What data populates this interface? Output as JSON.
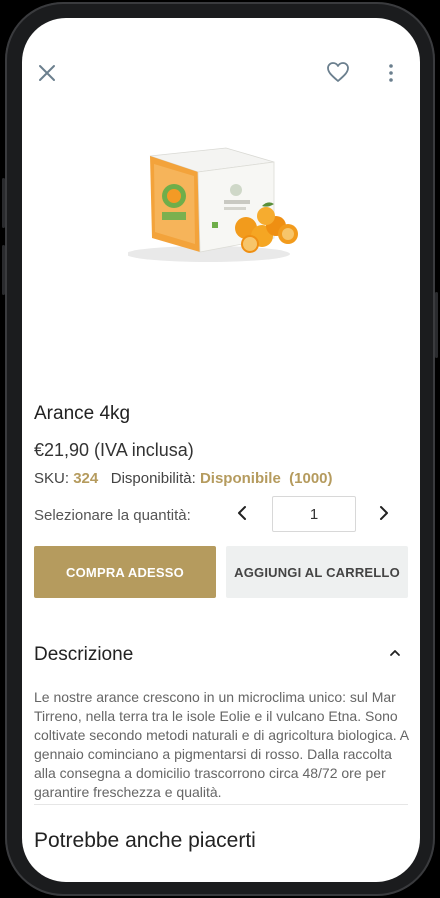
{
  "header": {
    "close_icon": "close-icon",
    "favorite_icon": "heart-icon",
    "menu_icon": "more-vertical-icon"
  },
  "product": {
    "title": "Arance 4kg",
    "price": "€21,90 (IVA inclusa)",
    "sku_label": "SKU:",
    "sku_value": "324",
    "availability_label": "Disponibilità:",
    "availability_value": "Disponibile",
    "availability_count": "(1000)"
  },
  "quantity": {
    "label": "Selezionare la quantità:",
    "value": "1"
  },
  "actions": {
    "buy_now": "COMPRA ADESSO",
    "add_to_cart": "AGGIUNGI AL CARRELLO"
  },
  "description": {
    "heading": "Descrizione",
    "text": "Le nostre arance crescono in un microclima unico: sul Mar Tirreno, nella terra tra le isole Eolie  e il vulcano Etna. Sono coltivate secondo metodi naturali e di agricoltura biologica. A gennaio cominciano a pigmentarsi di rosso. Dalla raccolta alla consegna a domicilio trascorrono circa 48/72 ore per garantire freschezza e qualità."
  },
  "recommendations": {
    "heading": "Potrebbe anche piacerti"
  },
  "colors": {
    "accent": "#b59b5e",
    "secondary_button": "#eef0f0"
  }
}
